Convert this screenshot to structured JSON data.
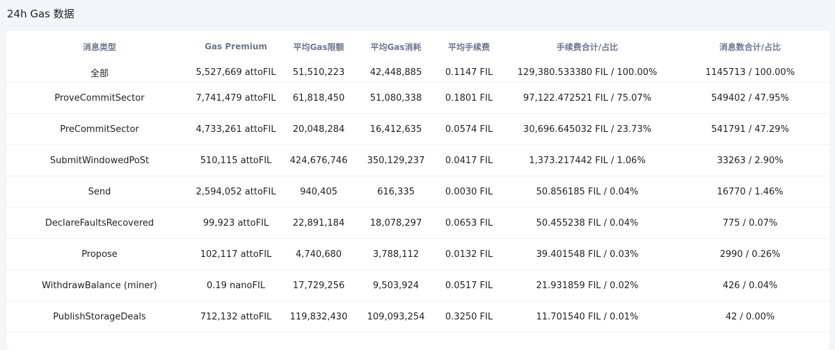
{
  "page": {
    "title": "24h Gas 数据"
  },
  "table": {
    "columns": [
      "消息类型",
      "Gas Premium",
      "平均Gas限额",
      "平均Gas消耗",
      "平均手续费",
      "手续费合计/占比",
      "消息数合计/占比"
    ],
    "rows": [
      [
        "全部",
        "5,527,669 attoFIL",
        "51,510,223",
        "42,448,885",
        "0.1147 FIL",
        "129,380.533380 FIL / 100.00%",
        "1145713 / 100.00%"
      ],
      [
        "ProveCommitSector",
        "7,741,479 attoFIL",
        "61,818,450",
        "51,080,338",
        "0.1801 FIL",
        "97,122.472521 FIL / 75.07%",
        "549402 / 47.95%"
      ],
      [
        "PreCommitSector",
        "4,733,261 attoFIL",
        "20,048,284",
        "16,412,635",
        "0.0574 FIL",
        "30,696.645032 FIL / 23.73%",
        "541791 / 47.29%"
      ],
      [
        "SubmitWindowedPoSt",
        "510,115 attoFIL",
        "424,676,746",
        "350,129,237",
        "0.0417 FIL",
        "1,373.217442 FIL / 1.06%",
        "33263 / 2.90%"
      ],
      [
        "Send",
        "2,594,052 attoFIL",
        "940,405",
        "616,335",
        "0.0030 FIL",
        "50.856185 FIL / 0.04%",
        "16770 / 1.46%"
      ],
      [
        "DeclareFaultsRecovered",
        "99,923 attoFIL",
        "22,891,184",
        "18,078,297",
        "0.0653 FIL",
        "50.455238 FIL / 0.04%",
        "775 / 0.07%"
      ],
      [
        "Propose",
        "102,117 attoFIL",
        "4,740,680",
        "3,788,112",
        "0.0132 FIL",
        "39.401548 FIL / 0.03%",
        "2990 / 0.26%"
      ],
      [
        "WithdrawBalance (miner)",
        "0.19 nanoFIL",
        "17,729,256",
        "9,503,924",
        "0.0517 FIL",
        "21.931859 FIL / 0.02%",
        "426 / 0.04%"
      ],
      [
        "PublishStorageDeals",
        "712,132 attoFIL",
        "119,832,430",
        "109,093,254",
        "0.3250 FIL",
        "11.701540 FIL / 0.01%",
        "42 / 0.00%"
      ]
    ]
  }
}
